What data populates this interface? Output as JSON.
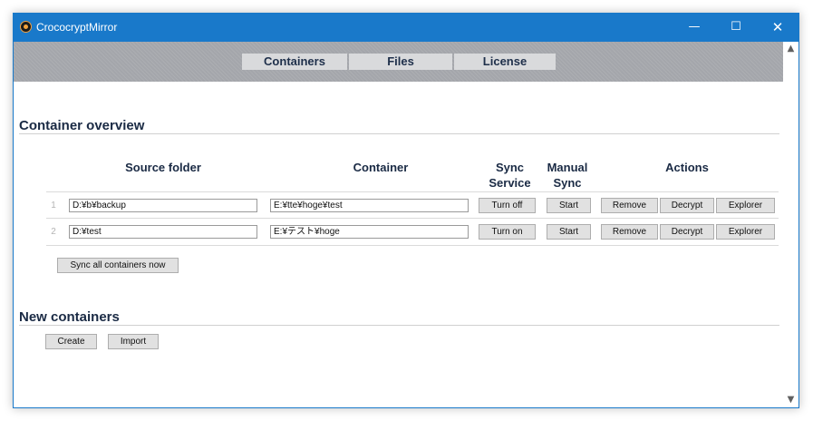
{
  "window": {
    "title": "CrococryptMirror",
    "minimize_glyph": "—",
    "maximize_glyph": "☐",
    "close_glyph": "✕",
    "accent": "#1979ca"
  },
  "scrollbar": {
    "up_glyph": "▲",
    "down_glyph": "▼"
  },
  "tabs": [
    "Containers",
    "Files",
    "License"
  ],
  "overview": {
    "heading": "Container overview",
    "columns": {
      "source": "Source folder",
      "container": "Container",
      "sync_service": [
        "Sync",
        "Service"
      ],
      "manual_sync": [
        "Manual",
        "Sync"
      ],
      "actions": "Actions"
    },
    "rows": [
      {
        "num": "1",
        "source": "D:¥b¥backup",
        "container": "E:¥tte¥hoge¥test",
        "sync_toggle": "Turn off",
        "start": "Start",
        "remove": "Remove",
        "decrypt": "Decrypt",
        "explorer": "Explorer"
      },
      {
        "num": "2",
        "source": "D:¥test",
        "container": "E:¥テスト¥hoge",
        "sync_toggle": "Turn on",
        "start": "Start",
        "remove": "Remove",
        "decrypt": "Decrypt",
        "explorer": "Explorer"
      }
    ],
    "sync_all": "Sync all containers now"
  },
  "new_containers": {
    "heading": "New containers",
    "create": "Create",
    "import": "Import"
  }
}
